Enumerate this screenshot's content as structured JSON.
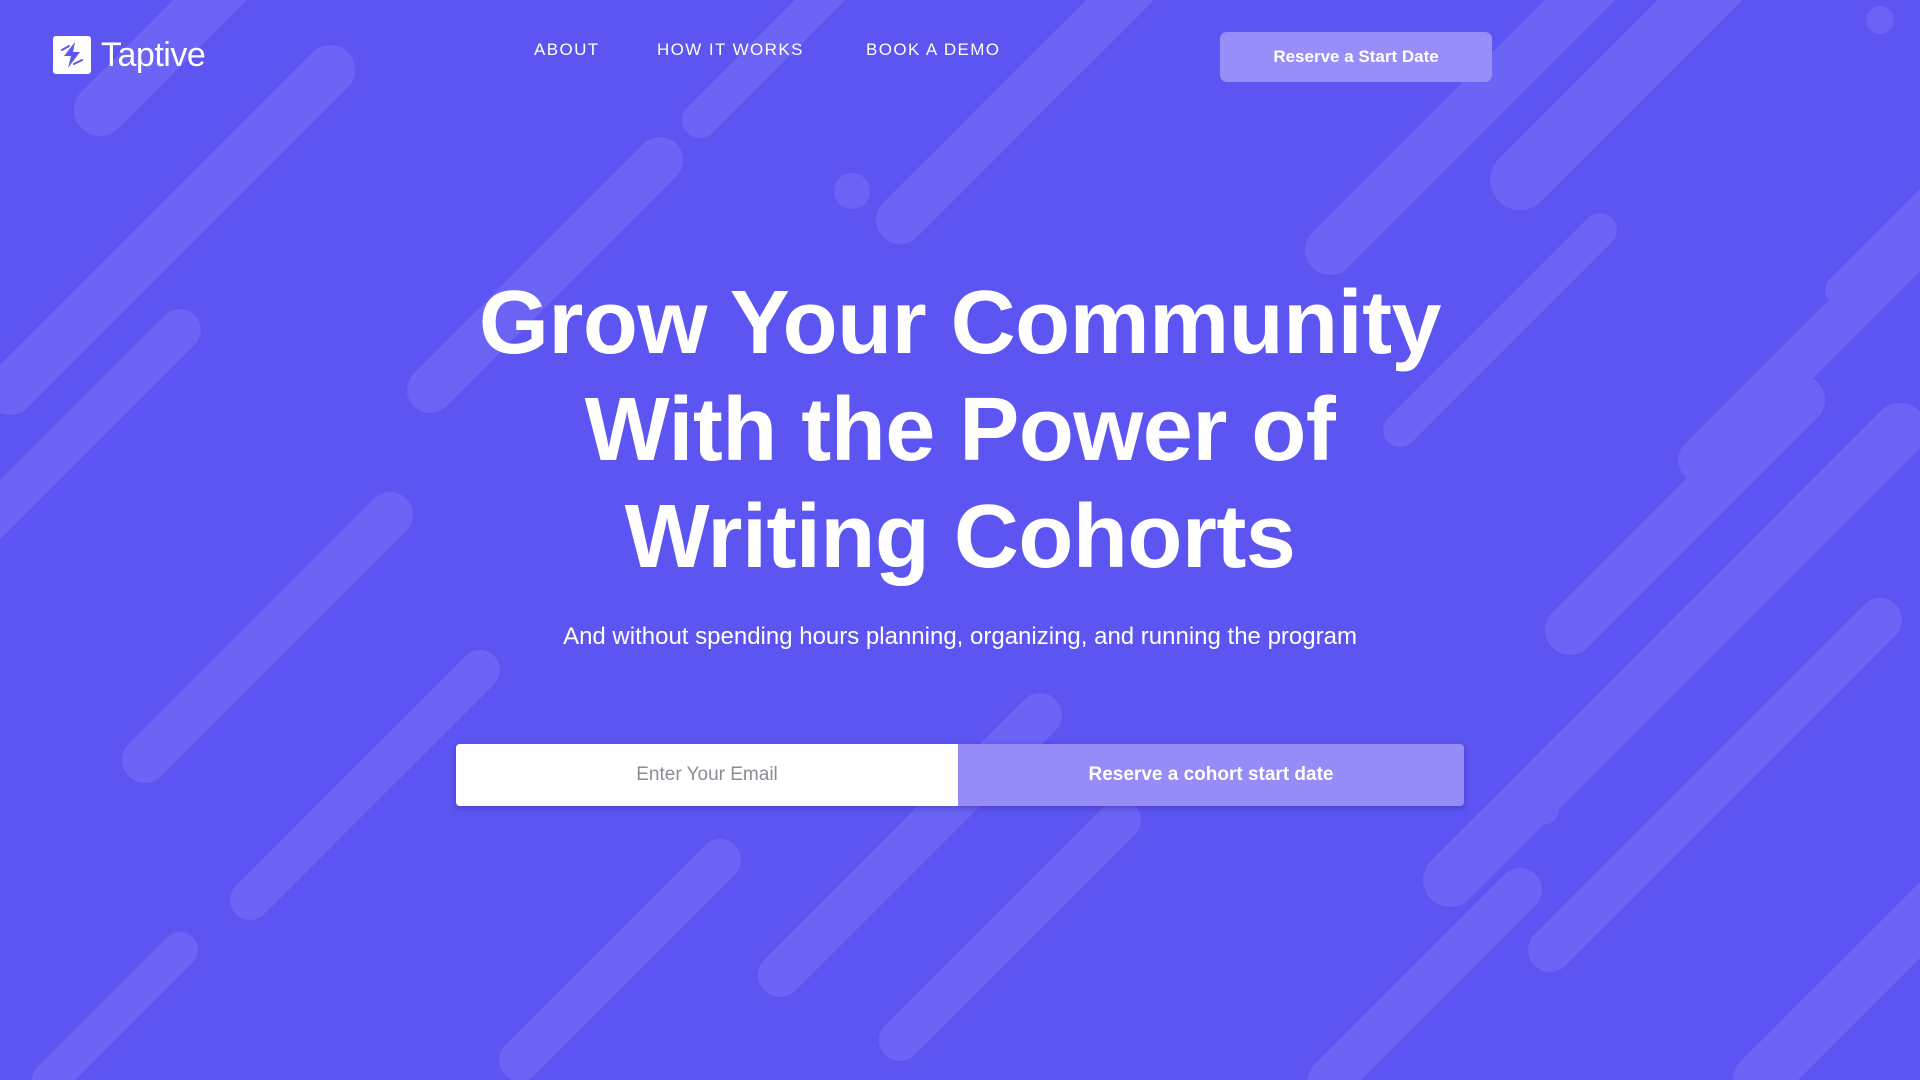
{
  "header": {
    "brand_name": "Taptive",
    "brand_icon": "lightning-logo-icon",
    "nav": [
      {
        "label": "ABOUT"
      },
      {
        "label": "HOW IT WORKS"
      },
      {
        "label": "BOOK A DEMO"
      }
    ],
    "cta_label": "Reserve a Start Date"
  },
  "hero": {
    "title_lines": [
      "Grow Your Community",
      "With the Power of",
      "Writing Cohorts"
    ],
    "subtitle": "And without spending hours planning, organizing, and running the program"
  },
  "signup": {
    "email_placeholder": "Enter Your Email",
    "email_value": "",
    "button_label": "Reserve a cohort start date"
  },
  "colors": {
    "background": "#5c55f2",
    "button_light": "#978ef7",
    "text": "#ffffff"
  }
}
